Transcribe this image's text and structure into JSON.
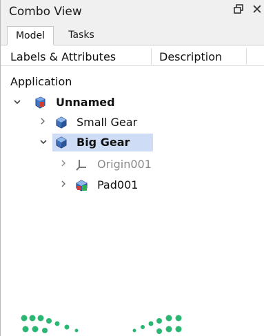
{
  "window": {
    "title": "Combo View",
    "float_icon": "float-window-icon",
    "close_icon": "close-icon",
    "close_glyph": "✕"
  },
  "tabs": [
    {
      "label": "Model",
      "active": true
    },
    {
      "label": "Tasks",
      "active": false
    }
  ],
  "tree": {
    "columns": [
      "Labels & Attributes",
      "Description"
    ],
    "section": "Application",
    "items": [
      {
        "label": "Unnamed",
        "icon": "document-icon",
        "expanded": true,
        "bold": true
      },
      {
        "label": "Small Gear",
        "icon": "body-icon",
        "expanded": false,
        "bold": false
      },
      {
        "label": "Big Gear",
        "icon": "body-icon",
        "expanded": true,
        "bold": true,
        "selected": true
      },
      {
        "label": "Origin001",
        "icon": "origin-axis-icon",
        "expanded": false,
        "bold": false,
        "dimmed": true
      },
      {
        "label": "Pad001",
        "icon": "pad-feature-icon",
        "expanded": false,
        "bold": false
      }
    ]
  },
  "colors": {
    "selection": "#cfdcf5",
    "dots": "#2bb673"
  }
}
